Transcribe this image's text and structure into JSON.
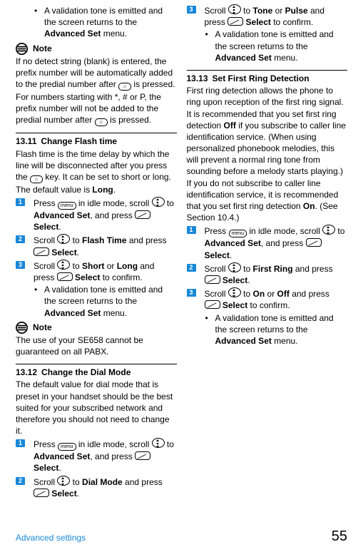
{
  "top": {
    "bullet": "A validation tone is emitted and the screen returns to the ",
    "bullet_bold": "Advanced Set",
    "bullet_tail": " menu."
  },
  "note1": {
    "label": "Note",
    "body_parts": [
      "If no detect string (blank) is entered, the prefix number will be automatically added to the predial number after ",
      " is pressed.",
      "For numbers starting with *, # or P, the prefix number will not be added to the predial number after ",
      " is pressed."
    ]
  },
  "sec1311": {
    "num": "13.11",
    "title": "Change Flash time",
    "intro1": "Flash time is the time delay by which the line will be disconnected after you press the ",
    "intro2": " key. It can be set to short or long.",
    "defline_a": "The default value is ",
    "defline_b": "Long",
    "defline_c": ".",
    "step1a": "Press ",
    "step1b": " in idle mode, scroll ",
    "step1c": " to ",
    "step1_bold": "Advanced Set",
    "step1d": ", and press ",
    "step1_bold2": "Select",
    "step1e": ".",
    "step2a": "Scroll ",
    "step2b": " to ",
    "step2_bold": "Flash Time",
    "step2c": " and press ",
    "step2_bold2": "Select",
    "step2d": ".",
    "step3a": "Scroll ",
    "step3b": " to ",
    "step3_bold1": "Short",
    "step3_or": " or ",
    "step3_bold2": "Long",
    "step3c": " and press ",
    "step3_bold3": "Select",
    "step3d": " to confirm.",
    "bullet": "A validation tone is emitted and the screen returns to the ",
    "bullet_bold": "Advanced Set",
    "bullet_tail": " menu."
  },
  "note2": {
    "label": "Note",
    "body": "The use of your SE658 cannot be guaranteed on all PABX."
  },
  "sec1312": {
    "num": "13.12",
    "title": "Change the Dial Mode",
    "intro": "The default value for dial mode that is preset in your handset should be the best suited for your subscribed network and therefore you should not need to change it.",
    "step1a": "Press ",
    "step1b": " in idle mode, scroll ",
    "step1c": " to ",
    "step1_bold": "Advanced Set",
    "step1d": ", and press ",
    "step1_bold2": "Select",
    "step1e": ".",
    "step2a": "Scroll ",
    "step2b": " to ",
    "step2_bold": "Dial Mode",
    "step2c": " and press ",
    "step2_bold2": "Select",
    "step2d": ".",
    "step3a": "Scroll ",
    "step3b": " to ",
    "step3_bold1": "Tone",
    "step3_or": " or ",
    "step3_bold2": "Pulse",
    "step3c": " and press ",
    "step3_bold3": "Select",
    "step3d": " to confirm.",
    "bullet": "A validation tone is emitted and the screen returns to the ",
    "bullet_bold": "Advanced Set",
    "bullet_tail": " menu."
  },
  "sec1313": {
    "num": "13.13",
    "title": "Set First Ring Detection",
    "intro_parts": [
      "First ring detection allows the phone to ring upon reception of the first ring signal. It is recommended that you set first ring detection ",
      "Off",
      " if you subscribe to caller line identification service. (When using personalized phonebook melodies, this will prevent a normal ring tone from sounding before a melody starts playing.) If you do not subscribe to caller line identification service, it is recommended that you set first ring detection ",
      "On",
      ". (See Section 10.4.)"
    ],
    "step1a": "Press ",
    "step1b": " in idle mode, scroll ",
    "step1c": " to ",
    "step1_bold": "Advanced Set",
    "step1d": ", and press ",
    "step1_bold2": "Select",
    "step1e": ".",
    "step2a": "Scroll ",
    "step2b": " to ",
    "step2_bold": "First Ring",
    "step2c": " and press ",
    "step2_bold2": "Select",
    "step2d": ".",
    "step3a": "Scroll ",
    "step3b": " to ",
    "step3_bold1": "On",
    "step3_or": " or ",
    "step3_bold2": "Off",
    "step3c": " and press ",
    "step3_bold3": "Select",
    "step3d": " to confirm.",
    "bullet": "A validation tone is emitted and the screen returns to the ",
    "bullet_bold": "Advanced Set",
    "bullet_tail": " menu."
  },
  "footer": {
    "label": "Advanced settings",
    "page": "55"
  },
  "icons": {
    "menu_key": "menu",
    "nav_key": "nav",
    "soft_key": "soft",
    "hangup_key": "hangup"
  }
}
